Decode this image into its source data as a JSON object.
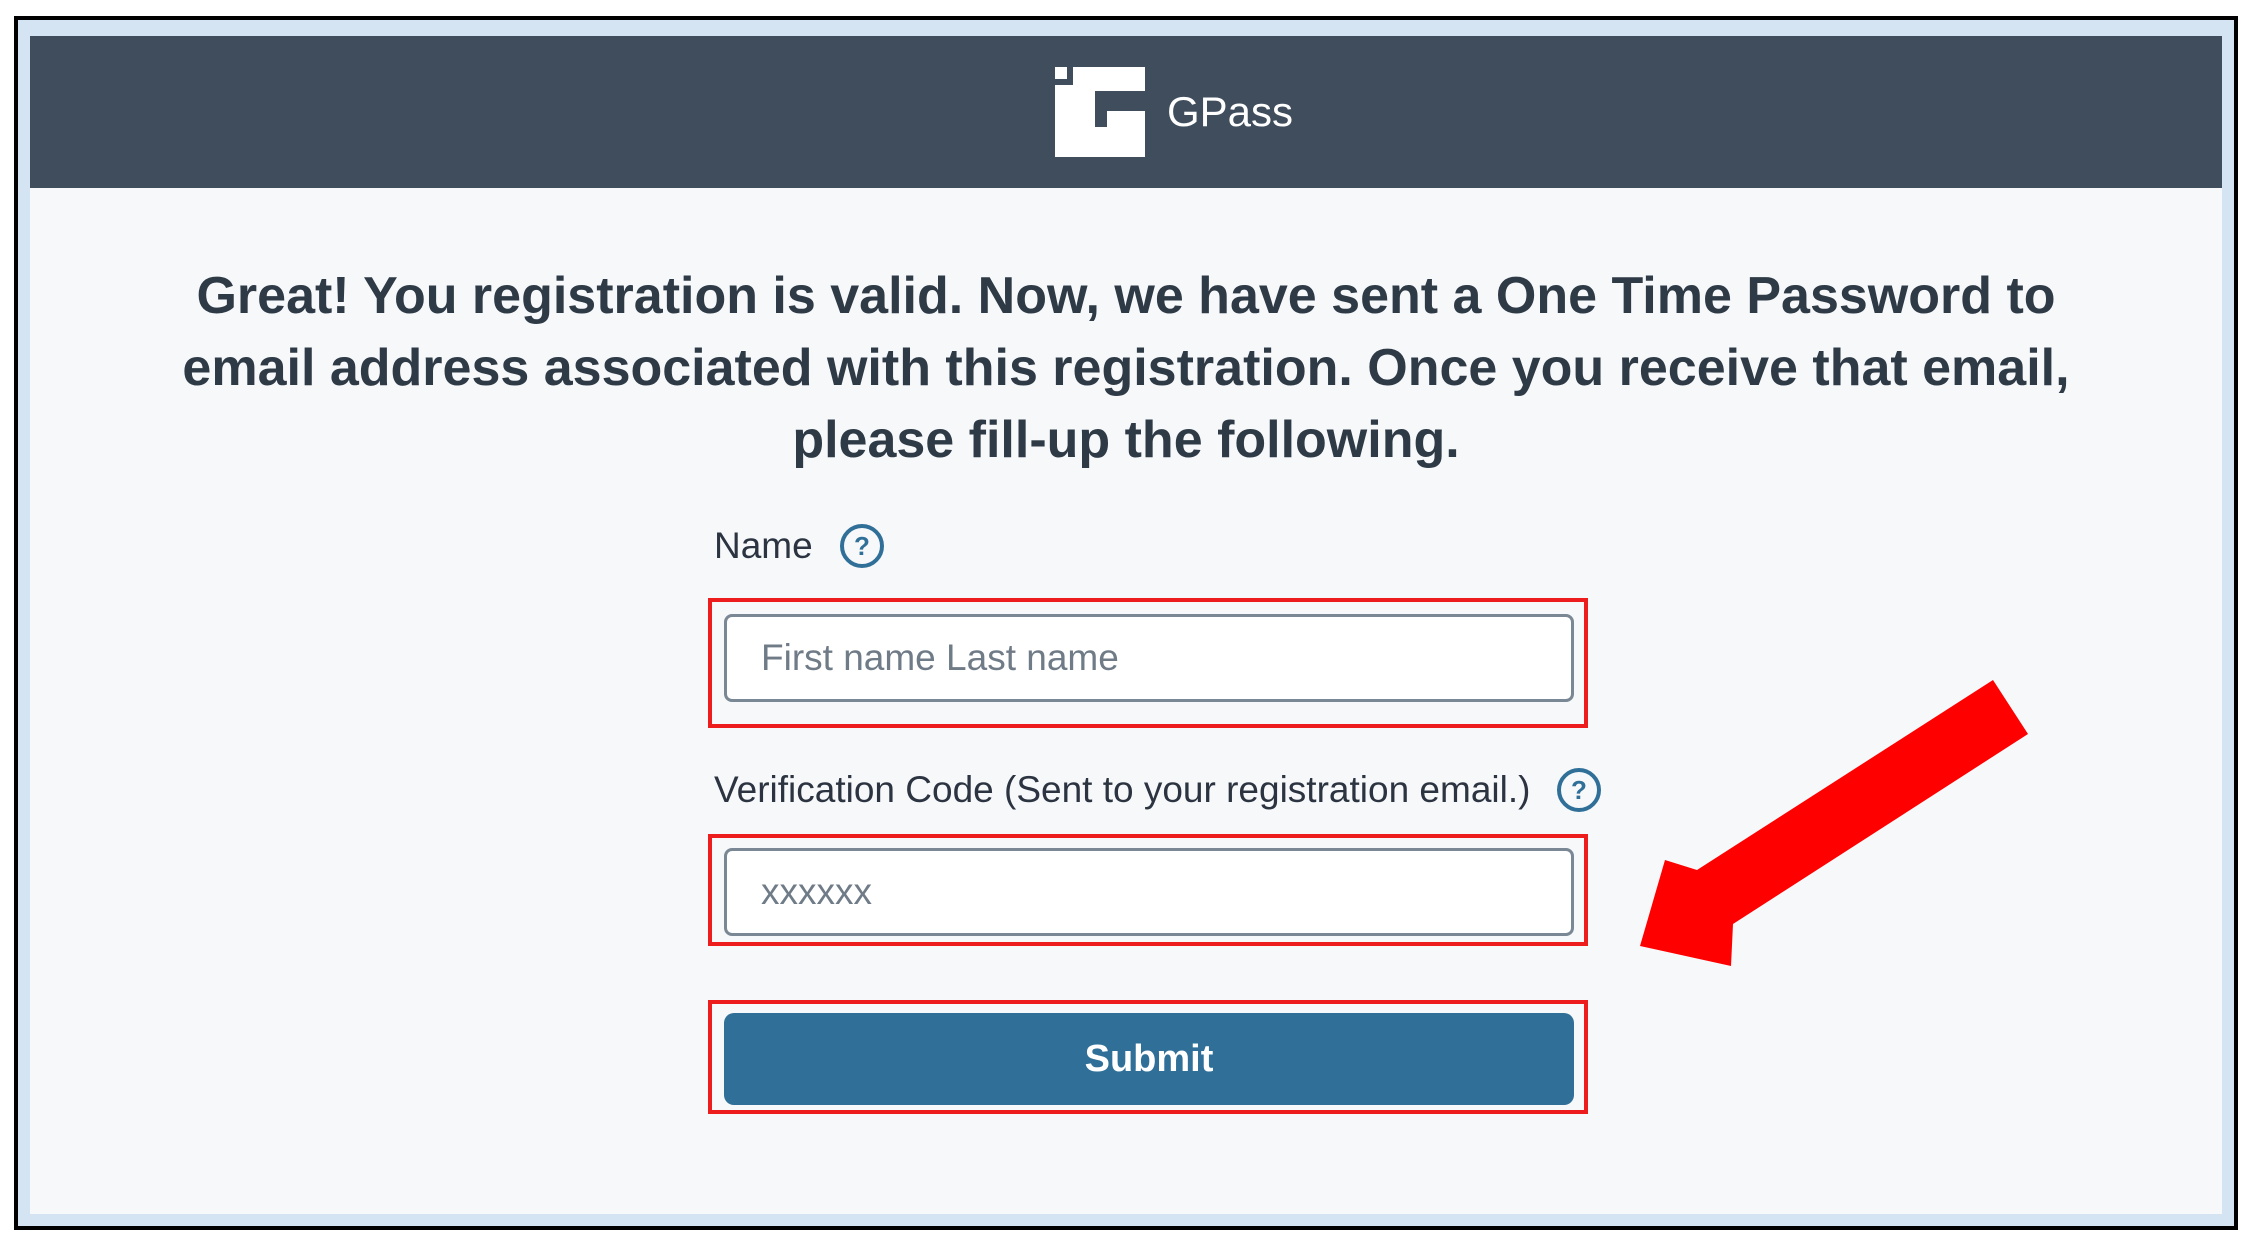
{
  "header": {
    "app_name": "GPass",
    "logo_icon": "gpass-logo-icon",
    "background_color": "#3f4d5d"
  },
  "main": {
    "message": "Great! You registration is valid. Now, we have sent a One Time Password to email address associated with this registration. Once you receive that email, please fill-up the following."
  },
  "form": {
    "name": {
      "label": "Name",
      "help_icon": "help-circle-icon",
      "value": "",
      "placeholder": "First name Last name"
    },
    "verification_code": {
      "label": "Verification Code (Sent to your registration email.)",
      "help_icon": "help-circle-icon",
      "value": "",
      "placeholder": "xxxxxx"
    },
    "submit_label": "Submit"
  },
  "annotations": {
    "highlight_color": "#ee1d1d",
    "arrow_icon": "red-arrow-pointing-down-left",
    "arrow_color": "#ff0000"
  },
  "theme": {
    "page_background": "#f7f8fa",
    "frame_background": "#d4e4f3",
    "primary_button": "#2f6f98",
    "text_color": "#2e3a46",
    "help_icon_color": "#2f6f98"
  }
}
